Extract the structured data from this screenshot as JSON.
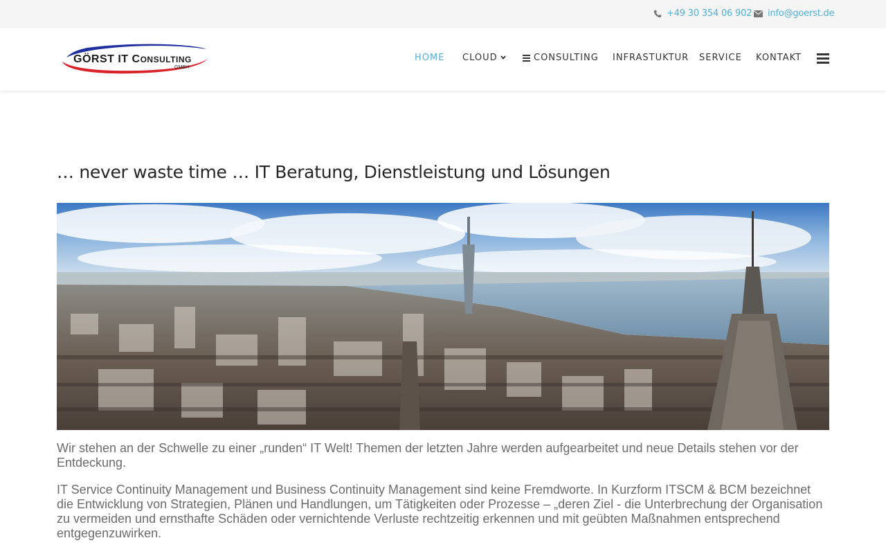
{
  "topbar": {
    "phone": "+49 30 354 06 902",
    "email": "info@goerst.de",
    "phone_icon": "phone-icon",
    "email_icon": "envelope-icon"
  },
  "logo": {
    "line1": "GÖRST IT CONSULTING",
    "line2": "GMBH"
  },
  "nav": {
    "items": [
      {
        "label": "HOME",
        "active": true
      },
      {
        "label": "CLOUD",
        "has_dropdown": true
      },
      {
        "label": "CONSULTING",
        "icon": "list-icon"
      },
      {
        "label": "INFRASTUKTUR"
      },
      {
        "label": "SERVICE"
      },
      {
        "label": "KONTAKT"
      }
    ],
    "menu_icon": "hamburger-icon"
  },
  "main": {
    "title": "… never waste time … IT Beratung, Dienstleistung und Lösungen",
    "paragraphs": [
      "Wir stehen an der Schwelle zu einer „runden“ IT Welt!  Themen der letzten Jahre werden aufgearbeitet und neue Details stehen vor der Entdeckung.",
      "IT Service Continuity Management und Business Continuity Management sind keine Fremdworte. In Kurzform ITSCM & BCM bezeichnet die Entwicklung von Strategien, Plänen und Handlungen, um Tätigkeiten oder Prozesse – „deren Ziel - die Unterbrechung der Organisation zu vermeiden und ernsthafte Schäden oder vernichtende Verluste rechtzeitig erkennen und mit geübten Maßnahmen entsprechend entgegenzuwirken."
    ]
  },
  "colors": {
    "accent": "#4fb0d8",
    "text": "#333333",
    "body_text": "#6b6b6b",
    "logo_red": "#d9232a",
    "logo_blue": "#1f2f9f"
  }
}
